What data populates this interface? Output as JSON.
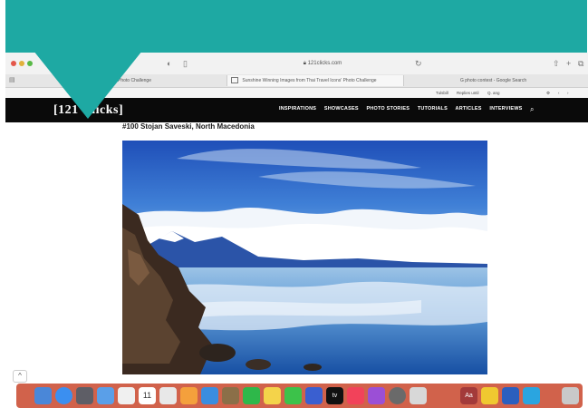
{
  "browser": {
    "address": "121clicks.com",
    "tabs": [
      {
        "label": "Photo Challenge"
      },
      {
        "label": "Sunshine Winning Images from Thai Travel Icons' Photo Challenge"
      },
      {
        "label": "photo contest - Google Search"
      }
    ],
    "bookmarks": {
      "item1": "Tulsbill",
      "item2": "Replies until",
      "item3": "Q. ang"
    }
  },
  "site": {
    "logo": "[121 Clicks]",
    "nav": [
      "INSPIRATIONS",
      "SHOWCASES",
      "PHOTO STORIES",
      "TUTORIALS",
      "ARTICLES",
      "INTERVIEWS"
    ]
  },
  "article": {
    "heading": "#100 Stojan Saveski, North Macedonia"
  },
  "dock": {
    "calendar_day": "11",
    "dictionary_label": "Aa",
    "tv_label": "tv"
  },
  "colors": {
    "banner": "#1ea9a3",
    "nav_background": "#0a0a0a",
    "dock_tint": "#cd553c"
  }
}
